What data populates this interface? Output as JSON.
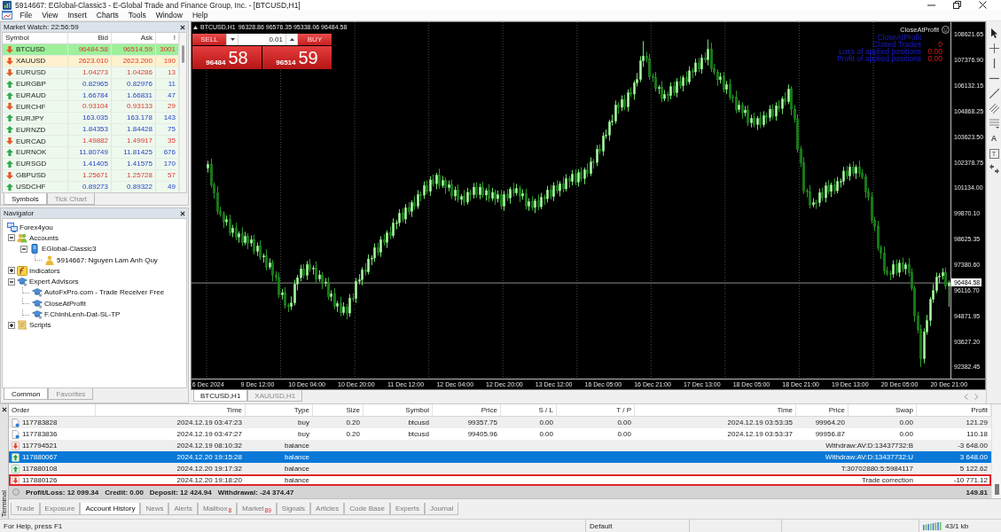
{
  "window": {
    "title": "5914667: EGlobal-Classic3 - E-Global Trade and Finance Group, Inc. - [BTCUSD,H1]"
  },
  "menu": [
    "File",
    "View",
    "Insert",
    "Charts",
    "Tools",
    "Window",
    "Help"
  ],
  "market_watch": {
    "title": "Market Watch: 22:56:59",
    "columns": [
      "Symbol",
      "Bid",
      "Ask",
      "!"
    ],
    "rows": [
      {
        "symbol": "BTCUSD",
        "bid": "96484.58",
        "ask": "96514.59",
        "spread": "3001",
        "rising": false,
        "color": "#9ef09b"
      },
      {
        "symbol": "XAUUSD",
        "bid": "2623.010",
        "ask": "2623.200",
        "spread": "190",
        "rising": false,
        "color": "#fdf1cf"
      },
      {
        "symbol": "EURUSD",
        "bid": "1.04273",
        "ask": "1.04286",
        "spread": "13",
        "rising": false,
        "color": "#eef9ee"
      },
      {
        "symbol": "EURGBP",
        "bid": "0.82965",
        "ask": "0.82976",
        "spread": "11",
        "rising": true,
        "color": "#eef9ee"
      },
      {
        "symbol": "EURAUD",
        "bid": "1.66784",
        "ask": "1.66831",
        "spread": "47",
        "rising": true,
        "color": "#eef9ee"
      },
      {
        "symbol": "EURCHF",
        "bid": "0.93104",
        "ask": "0.93133",
        "spread": "29",
        "rising": false,
        "color": "#eef9ee"
      },
      {
        "symbol": "EURJPY",
        "bid": "163.035",
        "ask": "163.178",
        "spread": "143",
        "rising": true,
        "color": "#eef9ee"
      },
      {
        "symbol": "EURNZD",
        "bid": "1.84353",
        "ask": "1.84428",
        "spread": "75",
        "rising": true,
        "color": "#eef9ee"
      },
      {
        "symbol": "EURCAD",
        "bid": "1.49882",
        "ask": "1.49917",
        "spread": "35",
        "rising": false,
        "color": "#eef9ee"
      },
      {
        "symbol": "EURNOK",
        "bid": "11.80749",
        "ask": "11.81425",
        "spread": "676",
        "rising": true,
        "color": "#eef9ee"
      },
      {
        "symbol": "EURSGD",
        "bid": "1.41405",
        "ask": "1.41575",
        "spread": "170",
        "rising": true,
        "color": "#eef9ee"
      },
      {
        "symbol": "GBPUSD",
        "bid": "1.25671",
        "ask": "1.25728",
        "spread": "57",
        "rising": false,
        "color": "#eef9ee"
      },
      {
        "symbol": "USDCHF",
        "bid": "0.89273",
        "ask": "0.89322",
        "spread": "49",
        "rising": true,
        "color": "#eef9ee"
      }
    ],
    "tabs": [
      {
        "label": "Symbols",
        "selected": true
      },
      {
        "label": "Tick Chart",
        "selected": false
      }
    ]
  },
  "navigator": {
    "title": "Navigator",
    "tree": [
      {
        "label": "Forex4you",
        "kind": "broker",
        "children": [
          {
            "label": "Accounts",
            "kind": "accounts",
            "expanded": true,
            "children": [
              {
                "label": "EGlobal-Classic3",
                "kind": "server",
                "expanded": true,
                "children": [
                  {
                    "label": "5914667: Nguyen Lam Anh Quy",
                    "kind": "account"
                  }
                ]
              }
            ]
          },
          {
            "label": "Indicators",
            "kind": "indicators",
            "expanded": false
          },
          {
            "label": "Expert Advisors",
            "kind": "experts",
            "expanded": true,
            "children": [
              {
                "label": "AutoFxPro.com - Trade Receiver Free",
                "kind": "expert"
              },
              {
                "label": "CloseAtProfit",
                "kind": "expert"
              },
              {
                "label": "F.ChinhLenh-Dat-SL-TP",
                "kind": "expert"
              }
            ]
          },
          {
            "label": "Scripts",
            "kind": "scripts",
            "expanded": false
          }
        ]
      }
    ],
    "tabs": [
      {
        "label": "Common",
        "selected": true
      },
      {
        "label": "Favorites",
        "selected": false
      }
    ]
  },
  "chart": {
    "symbol": "BTCUSD,H1",
    "ohlc": "96328.86 96576.35 95338.06 96484.58",
    "trade_panel": {
      "sell": "SELL",
      "buy": "BUY",
      "lot": "0.01",
      "sell_price": "96484",
      "sell_pips": "58",
      "buy_price": "96514",
      "buy_pips": "59"
    },
    "expert": {
      "name": "CloseAtProfit",
      "lines": [
        {
          "label": "CloseAtProfit"
        },
        {
          "label": "Closed Trades",
          "value": "0"
        },
        {
          "label": "Loss of applied positions",
          "value": "0.00"
        },
        {
          "label": "Profit of applied positions",
          "value": "0.00"
        }
      ]
    },
    "chart_data": {
      "type": "candlestick",
      "ylim": [
        91810,
        109228
      ],
      "yticks": [
        108621.65,
        {
          "value": 107376.9,
          "label": "107376.90"
        },
        106132.15,
        104868.25,
        {
          "value": 103623.5,
          "label": "103623.50"
        },
        102378.75,
        {
          "value": 101134,
          "label": "101134.00"
        },
        {
          "value": 99870.1,
          "label": "99870.10"
        },
        98625.35,
        {
          "value": 97380.6,
          "label": "97380.60"
        },
        {
          "value": 96116.7,
          "label": "96116.70"
        },
        94871.95,
        {
          "value": 93627.2,
          "label": "93627.20"
        },
        92382.45
      ],
      "ref_lines": [
        {
          "axis": "y",
          "value": 96484.58,
          "label": "96484.58"
        }
      ],
      "categories": [
        "6 Dec 2024",
        null,
        null,
        null,
        null,
        null,
        null,
        null,
        null,
        null,
        null,
        null,
        null,
        null,
        null,
        null,
        "9 Dec 12:00",
        null,
        null,
        null,
        null,
        null,
        null,
        null,
        null,
        null,
        null,
        null,
        null,
        null,
        null,
        null,
        "10 Dec 04:00",
        null,
        null,
        null,
        null,
        null,
        null,
        null,
        null,
        null,
        null,
        null,
        null,
        null,
        null,
        null,
        "10 Dec 20:00",
        null,
        null,
        null,
        null,
        null,
        null,
        null,
        null,
        null,
        null,
        null,
        null,
        null,
        null,
        null,
        "11 Dec 12:00",
        null,
        null,
        null,
        null,
        null,
        null,
        null,
        null,
        null,
        null,
        null,
        null,
        null,
        null,
        null,
        "12 Dec 04:00",
        null,
        null,
        null,
        null,
        null,
        null,
        null,
        null,
        null,
        null,
        null,
        null,
        null,
        null,
        null,
        "12 Dec 20:00",
        null,
        null,
        null,
        null,
        null,
        null,
        null,
        null,
        null,
        null,
        null,
        null,
        null,
        null,
        null,
        "13 Dec 12:00",
        null,
        null,
        null,
        null,
        null,
        null,
        null,
        null,
        null,
        null,
        null,
        null,
        null,
        null,
        null,
        "16 Dec 05:00",
        null,
        null,
        null,
        null,
        null,
        null,
        null,
        null,
        null,
        null,
        null,
        null,
        null,
        null,
        null,
        "16 Dec 21:00",
        null,
        null,
        null,
        null,
        null,
        null,
        null,
        null,
        null,
        null,
        null,
        null,
        null,
        null,
        null,
        "17 Dec 13:00",
        null,
        null,
        null,
        null,
        null,
        null,
        null,
        null,
        null,
        null,
        null,
        null,
        null,
        null,
        null,
        "18 Dec 05:00",
        null,
        null,
        null,
        null,
        null,
        null,
        null,
        null,
        null,
        null,
        null,
        null,
        null,
        null,
        null,
        "18 Dec 21:00",
        null,
        null,
        null,
        null,
        null,
        null,
        null,
        null,
        null,
        null,
        null,
        null,
        null,
        null,
        null,
        "19 Dec 13:00",
        null,
        null,
        null,
        null,
        null,
        null,
        null,
        null,
        null,
        null,
        null,
        null,
        null,
        null,
        null,
        "20 Dec 05:00",
        null,
        null,
        null,
        null,
        null,
        null,
        null,
        null,
        null,
        null,
        null,
        null,
        null,
        null,
        null,
        "20 Dec 21:00"
      ],
      "ohlc": [
        [
          102100,
          102429,
          101900,
          102279
        ],
        [
          102279,
          102529,
          101159,
          101279
        ],
        [
          101279,
          101379,
          100629,
          100879
        ],
        [
          100879,
          101179,
          99838,
          99988
        ],
        [
          99988,
          100188,
          99746,
          99846
        ],
        [
          99846,
          99966,
          99182,
          99462
        ],
        [
          99462,
          99758,
          99302,
          99578
        ],
        [
          99578,
          99798,
          98813,
          98943
        ],
        [
          98943,
          99309,
          98743,
          99159
        ],
        [
          99159,
          99409,
          98603,
          98723
        ],
        [
          98723,
          98986,
          98473,
          98886
        ],
        [
          98886,
          99186,
          98300,
          98450
        ],
        [
          98450,
          98963,
          98350,
          98763
        ],
        [
          98763,
          98883,
          98153,
          98433
        ],
        [
          98433,
          98783,
          98273,
          98603
        ],
        [
          98603,
          98823,
          97893,
          98023
        ],
        [
          98023,
          98443,
          97823,
          98293
        ],
        [
          98293,
          98543,
          97628,
          97748
        ],
        [
          97748,
          97903,
          97498,
          97803
        ],
        [
          97803,
          98103,
          97108,
          97258
        ],
        [
          97258,
          97663,
          97158,
          97463
        ],
        [
          97463,
          97583,
          96579,
          96859
        ],
        [
          96859,
          97039,
          96594,
          96754
        ],
        [
          96754,
          96974,
          95770,
          95900
        ],
        [
          95900,
          96161,
          95700,
          96011
        ],
        [
          96011,
          96261,
          95252,
          95372
        ],
        [
          95372,
          95472,
          95083,
          95333
        ],
        [
          95333,
          95803,
          95183,
          95503
        ],
        [
          95503,
          96623,
          95403,
          96423
        ],
        [
          96423,
          96863,
          96143,
          96743
        ],
        [
          96743,
          97353,
          96583,
          97173
        ],
        [
          97173,
          97393,
          96723,
          96853
        ],
        [
          96853,
          97533,
          96653,
          97383
        ],
        [
          97383,
          97633,
          97043,
          97163
        ],
        [
          97163,
          97318,
          96913,
          97218
        ],
        [
          97218,
          97518,
          96523,
          96673
        ],
        [
          96673,
          97078,
          96573,
          96878
        ],
        [
          96878,
          96998,
          96203,
          96483
        ],
        [
          96483,
          96703,
          96323,
          96523
        ],
        [
          96523,
          96743,
          95683,
          95813
        ],
        [
          95813,
          96103,
          95613,
          95953
        ],
        [
          95953,
          96203,
          95223,
          95343
        ],
        [
          95343,
          95585,
          95093,
          95485
        ],
        [
          95485,
          95785,
          94877,
          95027
        ],
        [
          95027,
          95518,
          94927,
          95318
        ],
        [
          95318,
          95438,
          94730,
          95010
        ],
        [
          95010,
          95923,
          94850,
          95743
        ],
        [
          95743,
          95963,
          95596,
          95726
        ],
        [
          95726,
          96710,
          95526,
          96560
        ],
        [
          96560,
          96893,
          96440,
          96643
        ],
        [
          96643,
          97231,
          96393,
          97131
        ],
        [
          97131,
          97431,
          96870,
          97020
        ],
        [
          97020,
          97858,
          96920,
          97658
        ],
        [
          97658,
          97816,
          97378,
          97696
        ],
        [
          97696,
          98393,
          97536,
          98213
        ],
        [
          98213,
          98433,
          97850,
          97980
        ],
        [
          97980,
          98746,
          97780,
          98596
        ],
        [
          98596,
          98846,
          98343,
          98463
        ],
        [
          98463,
          99030,
          98213,
          98930
        ],
        [
          98930,
          99230,
          98646,
          98796
        ],
        [
          98796,
          99613,
          98696,
          99413
        ],
        [
          99413,
          99549,
          99133,
          99429
        ],
        [
          99429,
          100072,
          99269,
          99892
        ],
        [
          99892,
          100112,
          99474,
          99604
        ],
        [
          99604,
          100317,
          99404,
          100167
        ],
        [
          100167,
          100417,
          99859,
          99979
        ],
        [
          99979,
          100502,
          99729,
          100402
        ],
        [
          100402,
          100702,
          100075,
          100225
        ],
        [
          100225,
          100999,
          100125,
          100799
        ],
        [
          100799,
          100919,
          100492,
          100772
        ],
        [
          100772,
          101426,
          100612,
          101246
        ],
        [
          101246,
          101466,
          100828,
          100958
        ],
        [
          100958,
          101671,
          100758,
          101521
        ],
        [
          101521,
          101771,
          101213,
          101333
        ],
        [
          101333,
          101846,
          101083,
          101746
        ],
        [
          101746,
          102046,
          101094,
          101244
        ],
        [
          101244,
          101692,
          101144,
          101492
        ],
        [
          101492,
          101612,
          100861,
          101141
        ],
        [
          101141,
          101469,
          100981,
          101289
        ],
        [
          101289,
          101509,
          100601,
          100731
        ],
        [
          100731,
          101173,
          100531,
          101023
        ],
        [
          101023,
          101273,
          100444,
          100564
        ],
        [
          100564,
          100806,
          100314,
          100706
        ],
        [
          100706,
          101006,
          100284,
          100434
        ],
        [
          100434,
          101112,
          100334,
          100912
        ],
        [
          100912,
          101032,
          100510,
          100790
        ],
        [
          100790,
          101348,
          100630,
          101168
        ],
        [
          101168,
          101388,
          100666,
          100796
        ],
        [
          100796,
          101313,
          100596,
          101163
        ],
        [
          101163,
          101413,
          100661,
          100781
        ],
        [
          100781,
          101098,
          100531,
          100998
        ],
        [
          100998,
          101298,
          100466,
          100616
        ],
        [
          100616,
          101108,
          100516,
          100908
        ],
        [
          100908,
          101028,
          100320,
          100600
        ],
        [
          100600,
          100971,
          100440,
          100791
        ],
        [
          100791,
          101011,
          100103,
          100233
        ],
        [
          100233,
          100956,
          100033,
          100806
        ],
        [
          100806,
          101056,
          100510,
          100630
        ],
        [
          100630,
          101153,
          100380,
          101053
        ],
        [
          101053,
          101353,
          100726,
          100876
        ],
        [
          100876,
          101303,
          100776,
          101103
        ],
        [
          101103,
          101223,
          100449,
          100729
        ],
        [
          100729,
          101036,
          100569,
          100856
        ],
        [
          100856,
          101076,
          100102,
          100232
        ],
        [
          100232,
          100609,
          100032,
          100459
        ],
        [
          100459,
          100709,
          100054,
          100174
        ],
        [
          100174,
          100589,
          99924,
          100489
        ],
        [
          100489,
          100789,
          100054,
          100204
        ],
        [
          100204,
          100869,
          100104,
          100669
        ],
        [
          100669,
          100789,
          100319,
          100599
        ],
        [
          100599,
          101209,
          100439,
          101029
        ],
        [
          101029,
          101249,
          100579,
          100709
        ],
        [
          100709,
          101389,
          100509,
          101239
        ],
        [
          101239,
          101489,
          100867,
          100987
        ],
        [
          100987,
          101434,
          100737,
          101334
        ],
        [
          101334,
          101634,
          100932,
          101082
        ],
        [
          101082,
          101779,
          100982,
          101579
        ],
        [
          101579,
          101699,
          101160,
          101440
        ],
        [
          101440,
          101981,
          101280,
          101801
        ],
        [
          101801,
          102021,
          101281,
          101411
        ],
        [
          101411,
          102022,
          101211,
          101872
        ],
        [
          101872,
          102122,
          101463,
          101583
        ],
        [
          101583,
          102106,
          101333,
          102006
        ],
        [
          102006,
          102306,
          101679,
          101829
        ],
        [
          101829,
          102603,
          101729,
          102403
        ],
        [
          102403,
          102523,
          102096,
          102376
        ],
        [
          102376,
          103203,
          102216,
          103023
        ],
        [
          103023,
          103243,
          102789,
          102919
        ],
        [
          102919,
          103816,
          102719,
          103666
        ],
        [
          103666,
          103956,
          103546,
          103706
        ],
        [
          103706,
          104446,
          103456,
          104346
        ],
        [
          104346,
          104686,
          104196,
          104386
        ],
        [
          104386,
          105376,
          104286,
          105176
        ],
        [
          105176,
          105296,
          104783,
          105063
        ],
        [
          105063,
          105629,
          104903,
          105449
        ],
        [
          105449,
          105669,
          104956,
          105086
        ],
        [
          105086,
          105925,
          104886,
          105775
        ],
        [
          105775,
          106025,
          105593,
          105713
        ],
        [
          105713,
          106352,
          105463,
          106252
        ],
        [
          106252,
          106722,
          106102,
          106422
        ],
        [
          106422,
          107542,
          106322,
          107342
        ],
        [
          107342,
          108280,
          107062,
          107575
        ],
        [
          107575,
          107755,
          107282,
          107442
        ],
        [
          107442,
          107662,
          106429,
          106559
        ],
        [
          106559,
          106709,
          106326,
          106526
        ],
        [
          106526,
          106776,
          105861,
          105981
        ],
        [
          105981,
          106136,
          105731,
          106036
        ],
        [
          106036,
          106336,
          105341,
          105491
        ],
        [
          105491,
          105896,
          105391,
          105696
        ],
        [
          105696,
          105816,
          105360,
          105640
        ],
        [
          105640,
          106265,
          105480,
          106085
        ],
        [
          106085,
          106305,
          105649,
          105779
        ],
        [
          105779,
          106473,
          105579,
          106323
        ],
        [
          106323,
          106573,
          105998,
          106118
        ],
        [
          106118,
          106612,
          105868,
          106512
        ],
        [
          106512,
          106812,
          106156,
          106306
        ],
        [
          106306,
          107051,
          106206,
          106851
        ],
        [
          106851,
          106971,
          106515,
          106795
        ],
        [
          106795,
          107420,
          106635,
          107240
        ],
        [
          107240,
          107460,
          106804,
          106934
        ],
        [
          106934,
          107629,
          106734,
          107479
        ],
        [
          107479,
          107729,
          107269,
          107389
        ],
        [
          107389,
          108360,
          107139,
          107899
        ],
        [
          107899,
          108199,
          106814,
          106964
        ],
        [
          106964,
          107164,
          106679,
          106779
        ],
        [
          106779,
          106899,
          106137,
          106417
        ],
        [
          106417,
          106734,
          106257,
          106554
        ],
        [
          106554,
          106774,
          105812,
          105942
        ],
        [
          105942,
          106329,
          105742,
          106179
        ],
        [
          106179,
          106429,
          105449,
          105569
        ],
        [
          105569,
          105669,
          105309,
          105559
        ],
        [
          105559,
          105859,
          104799,
          104949
        ],
        [
          104949,
          105376,
          104849,
          105176
        ],
        [
          105176,
          105296,
          104522,
          104802
        ],
        [
          104802,
          105109,
          104642,
          104929
        ],
        [
          104929,
          105149,
          104176,
          104306
        ],
        [
          104306,
          104682,
          104106,
          104532
        ],
        [
          104532,
          104782,
          104106,
          104226
        ],
        [
          104226,
          104619,
          103976,
          104519
        ],
        [
          104519,
          104819,
          104063,
          104213
        ],
        [
          104213,
          104856,
          104113,
          104656
        ],
        [
          104656,
          104776,
          104284,
          104564
        ],
        [
          104564,
          105153,
          104404,
          104973
        ],
        [
          104973,
          105193,
          104501,
          104631
        ],
        [
          104631,
          105289,
          104431,
          105139
        ],
        [
          105139,
          105389,
          104886,
          105006
        ],
        [
          105006,
          105573,
          104756,
          105473
        ],
        [
          105473,
          105773,
          105189,
          105339
        ],
        [
          105339,
          106156,
          105239,
          105956
        ],
        [
          105956,
          106076,
          104696,
          104976
        ],
        [
          104976,
          105156,
          104336,
          104496
        ],
        [
          104496,
          104716,
          102876,
          103006
        ],
        [
          103006,
          103156,
          102166,
          102366
        ],
        [
          102366,
          102616,
          100856,
          100976
        ],
        [
          100976,
          101076,
          100687,
          100937
        ],
        [
          100937,
          101237,
          100148,
          100298
        ],
        [
          100298,
          100609,
          100198,
          100409
        ],
        [
          100409,
          100529,
          100124,
          100404
        ],
        [
          100404,
          101079,
          100244,
          100899
        ],
        [
          100899,
          101119,
          100514,
          100644
        ],
        [
          100644,
          101389,
          100444,
          101239
        ],
        [
          101239,
          101489,
          100834,
          100954
        ],
        [
          100954,
          101369,
          100704,
          101269
        ],
        [
          101269,
          101569,
          100834,
          100984
        ],
        [
          100984,
          101649,
          100884,
          101449
        ],
        [
          101449,
          101571,
          101169,
          101451
        ],
        [
          101451,
          102134,
          101291,
          101954
        ],
        [
          101954,
          102174,
          101576,
          101706
        ],
        [
          101706,
          102299,
          101506,
          102149
        ],
        [
          102149,
          102399,
          101722,
          101842
        ],
        [
          101842,
          102236,
          101592,
          102136
        ],
        [
          102136,
          102436,
          101679,
          101829
        ],
        [
          101829,
          102029,
          101580,
          101680
        ],
        [
          101680,
          101800,
          100652,
          100932
        ],
        [
          100932,
          101112,
          100523,
          100683
        ],
        [
          100683,
          100903,
          99410,
          99540
        ],
        [
          99540,
          99690,
          99046,
          99246
        ],
        [
          99246,
          99496,
          98083,
          98203
        ],
        [
          98203,
          98303,
          97683,
          97933
        ],
        [
          97933,
          98233,
          96913,
          97063
        ],
        [
          97063,
          97263,
          96843,
          96943
        ],
        [
          96943,
          97063,
          96636,
          96916
        ],
        [
          96916,
          97570,
          96756,
          97390
        ],
        [
          97390,
          97610,
          96868,
          96998
        ],
        [
          96998,
          97605,
          96798,
          97455
        ],
        [
          97455,
          97705,
          97043,
          97163
        ],
        [
          97163,
          97469,
          96913,
          97369
        ],
        [
          97369,
          97669,
          96826,
          96976
        ],
        [
          96976,
          97176,
          96128,
          96228
        ],
        [
          96228,
          96348,
          94600,
          94880
        ],
        [
          94880,
          95060,
          94045,
          94205
        ],
        [
          94205,
          94425,
          92400,
          92780
        ],
        [
          92780,
          94240,
          92580,
          94090
        ],
        [
          94090,
          94900,
          93970,
          94650
        ],
        [
          94650,
          95780,
          94400,
          95680
        ],
        [
          95680,
          96410,
          95530,
          96110
        ],
        [
          96110,
          96970,
          96010,
          96770
        ],
        [
          96770,
          96950,
          96490,
          96830
        ],
        [
          96830,
          97180,
          96670,
          97000
        ],
        [
          97000,
          97220,
          96199,
          96328.86
        ],
        [
          96328.86,
          96576.35,
          95338.06,
          96484.58
        ]
      ]
    }
  },
  "drawing_tools": {
    "text": "A",
    "label": "T"
  },
  "chart_tabs": [
    {
      "label": "BTCUSD,H1",
      "selected": true
    },
    {
      "label": "XAUUSD,H1",
      "selected": false
    }
  ],
  "terminal": {
    "title": "Terminal",
    "columns": [
      "Order",
      "Time",
      "Type",
      "Size",
      "Symbol",
      "Price",
      "S / L",
      "T / P",
      "Time",
      "Price",
      "Swap",
      "Profit"
    ],
    "rows": [
      {
        "kind": "trade",
        "order": "117783828",
        "time": "2024.12.19 03:47:23",
        "type": "buy",
        "size": "0.20",
        "symbol": "btcusd",
        "price": "99357.75",
        "sl": "0.00",
        "tp": "0.00",
        "close_time": "2024.12.19 03:53:35",
        "close_price": "99964.20",
        "swap": "0.00",
        "profit": "121.29",
        "selected": false,
        "outlined": false
      },
      {
        "kind": "trade",
        "order": "117783836",
        "time": "2024.12.19 03:47:27",
        "type": "buy",
        "size": "0.20",
        "symbol": "btcusd",
        "price": "99405.96",
        "sl": "0.00",
        "tp": "0.00",
        "close_time": "2024.12.19 03:53:37",
        "close_price": "99956.87",
        "swap": "0.00",
        "profit": "110.18",
        "selected": false,
        "outlined": false
      },
      {
        "kind": "debit",
        "order": "117794521",
        "time": "2024.12.19 08:10:32",
        "type": "balance",
        "comment": "Withdraw:AV:D:13437732:B",
        "profit": "-3 648.00",
        "selected": false,
        "outlined": false
      },
      {
        "kind": "credit",
        "order": "117880067",
        "time": "2024.12.20 19:15:28",
        "type": "balance",
        "comment": "Withdraw:AV:D:13437732:U",
        "profit": "3 648.00",
        "selected": true,
        "outlined": false
      },
      {
        "kind": "credit",
        "order": "117880108",
        "time": "2024.12.20 19:17:32",
        "type": "balance",
        "comment": "T:30702880:5:5984117",
        "profit": "5 122.62",
        "selected": false,
        "outlined": false
      },
      {
        "kind": "debit",
        "order": "117880126",
        "time": "2024.12.20 19:18:20",
        "type": "balance",
        "comment": "Trade correction",
        "profit": "-10 771.12",
        "selected": false,
        "outlined": true
      }
    ],
    "summary": {
      "items": [
        "Profit/Loss: 12 099.34",
        "Credit: 0.00",
        "Deposit: 12 424.94",
        "Withdrawal: -24 374.47"
      ],
      "total": "149.81"
    },
    "tabs": [
      {
        "label": "Trade",
        "selected": false
      },
      {
        "label": "Exposure",
        "selected": false
      },
      {
        "label": "Account History",
        "selected": true
      },
      {
        "label": "News",
        "selected": false
      },
      {
        "label": "Alerts",
        "selected": false
      },
      {
        "label": "Mailbox",
        "count": "8",
        "selected": false
      },
      {
        "label": "Market",
        "count": "89",
        "selected": false
      },
      {
        "label": "Signals",
        "selected": false
      },
      {
        "label": "Articles",
        "selected": false
      },
      {
        "label": "Code Base",
        "selected": false
      },
      {
        "label": "Experts",
        "selected": false
      },
      {
        "label": "Journal",
        "selected": false
      }
    ]
  },
  "status_bar": {
    "help": "For Help, press F1",
    "profile": "Default",
    "traffic": "43/1 kb"
  }
}
